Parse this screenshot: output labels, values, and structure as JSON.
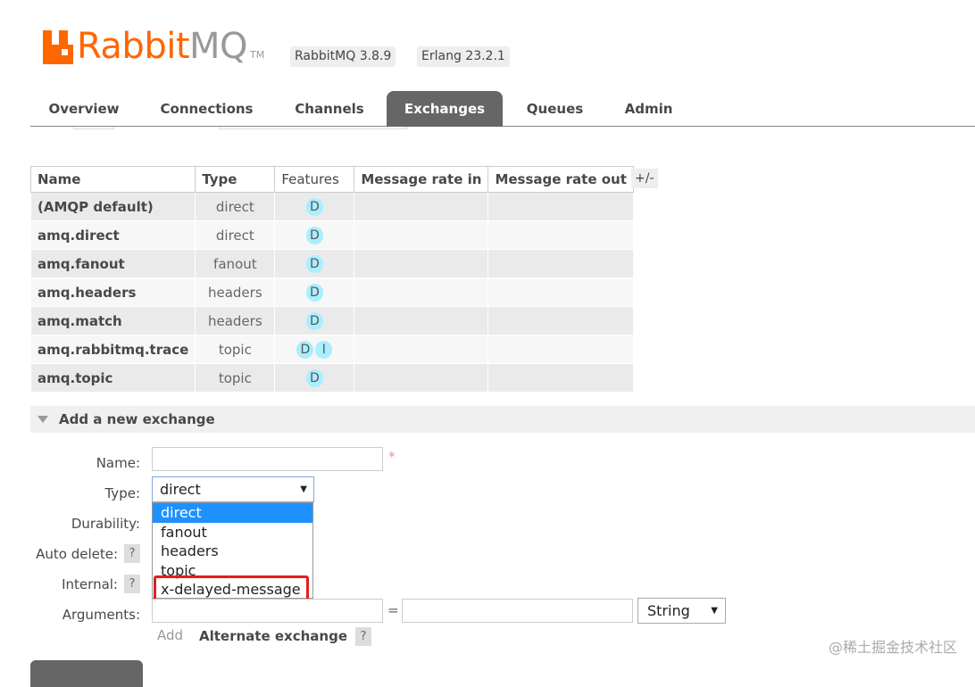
{
  "header": {
    "brand_primary": "Rabbit",
    "brand_secondary": "MQ",
    "trademark": "TM",
    "rabbitmq_version": "RabbitMQ 3.8.9",
    "erlang_version": "Erlang 23.2.1",
    "brand_color": "#ff6600"
  },
  "tabs": [
    {
      "label": "Overview",
      "active": false
    },
    {
      "label": "Connections",
      "active": false
    },
    {
      "label": "Channels",
      "active": false
    },
    {
      "label": "Exchanges",
      "active": true
    },
    {
      "label": "Queues",
      "active": false
    },
    {
      "label": "Admin",
      "active": false
    }
  ],
  "table": {
    "headers": [
      "Name",
      "Type",
      "Features",
      "Message rate in",
      "Message rate out"
    ],
    "toggle_columns": "+/-",
    "rows": [
      {
        "name": "(AMQP default)",
        "type": "direct",
        "features": [
          "D"
        ],
        "rate_in": "",
        "rate_out": ""
      },
      {
        "name": "amq.direct",
        "type": "direct",
        "features": [
          "D"
        ],
        "rate_in": "",
        "rate_out": ""
      },
      {
        "name": "amq.fanout",
        "type": "fanout",
        "features": [
          "D"
        ],
        "rate_in": "",
        "rate_out": ""
      },
      {
        "name": "amq.headers",
        "type": "headers",
        "features": [
          "D"
        ],
        "rate_in": "",
        "rate_out": ""
      },
      {
        "name": "amq.match",
        "type": "headers",
        "features": [
          "D"
        ],
        "rate_in": "",
        "rate_out": ""
      },
      {
        "name": "amq.rabbitmq.trace",
        "type": "topic",
        "features": [
          "D",
          "I"
        ],
        "rate_in": "",
        "rate_out": ""
      },
      {
        "name": "amq.topic",
        "type": "topic",
        "features": [
          "D"
        ],
        "rate_in": "",
        "rate_out": ""
      }
    ]
  },
  "add_exchange": {
    "title": "Add a new exchange",
    "labels": {
      "name": "Name:",
      "type": "Type:",
      "durability": "Durability:",
      "auto_delete": "Auto delete:",
      "internal": "Internal:",
      "arguments": "Arguments:"
    },
    "help_glyph": "?",
    "required_mark": "*",
    "name_value": "",
    "type_selected": "direct",
    "type_options": [
      "direct",
      "fanout",
      "headers",
      "topic",
      "x-delayed-message"
    ],
    "highlighted_option": "x-delayed-message",
    "highlight_color": "#e41e1e",
    "arg_key": "",
    "equals": "=",
    "arg_value": "",
    "arg_type": "String",
    "add_link": "Add",
    "alternate_exchange": "Alternate exchange"
  },
  "watermark": "@稀土掘金技术社区"
}
